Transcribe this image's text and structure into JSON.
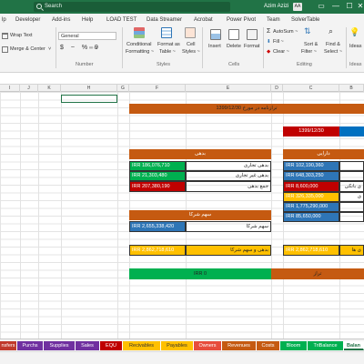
{
  "titlebar": {
    "search_placeholder": "Search",
    "user_name": "Azim Azizi",
    "avatar_initials": "AA",
    "minimize": "—",
    "maximize": "☐",
    "close": "✕"
  },
  "ribbon_tabs": [
    "lp",
    "Developer",
    "Add-ins",
    "Help",
    "LOAD TEST",
    "Data Streamer",
    "Acrobat",
    "Power Pivot",
    "Team",
    "SolverTable"
  ],
  "ribbon": {
    "wrap_text": "Wrap Text",
    "merge_center": "Merge & Center",
    "alignment_label": "",
    "number_format": "General",
    "number_symbols": "$ ~ % 9",
    "number_label": "Number",
    "conditional_formatting": [
      "Conditional",
      "Formatting ~"
    ],
    "format_as_table": [
      "Format as",
      "Table ~"
    ],
    "cell_styles": [
      "Cell",
      "Styles ~"
    ],
    "styles_label": "Styles",
    "insert": "Insert",
    "delete": "Delete",
    "format": "Format",
    "cells_label": "Cells",
    "autosum": "AutoSum ~",
    "fill": "Fill ~",
    "clear": "Clear ~",
    "sort_filter": [
      "Sort &",
      "Filter ~"
    ],
    "find_select": [
      "Find &",
      "Select ~"
    ],
    "editing_label": "Editing",
    "ideas": "Ideas",
    "ideas_label": "Ideas"
  },
  "columns": [
    "I",
    "J",
    "K",
    "H",
    "G",
    "F",
    "E",
    "D",
    "C",
    "B"
  ],
  "sheet": {
    "title": "ترازنامه در مورخ 1399/12/30",
    "date_cell": "1399/12/30",
    "liabilities_header": "بدهی",
    "assets_header": "دارایی",
    "liab_rows": [
      {
        "value": "IRR 186,076,710",
        "label": "بدهی تجاری"
      },
      {
        "value": "IRR 21,303,480",
        "label": "بدهی غیر تجاری"
      },
      {
        "value": "IRR 207,380,190",
        "label": "جمع بدهی"
      }
    ],
    "asset_values": [
      "IRR 102,190,360",
      "IRR 648,303,250",
      "IRR 8,600,000",
      "IRR 326,335,000",
      "IRR 1,775,290,000",
      "IRR 85,650,000"
    ],
    "asset_labels_partial": [
      "",
      "",
      "ی بانکی",
      "ی",
      "",
      ""
    ],
    "equity_header": "سهم شرکا",
    "equity_value": "IRR 2,655,338,420",
    "equity_label": "سهم شرکا",
    "total_liab_equity_value": "IRR 2,862,718,610",
    "total_liab_equity_label": "بدهی و سهم شرکا",
    "total_assets_value": "IRR 2,862,718,610",
    "total_assets_label": "ی ها",
    "diff_value": "IRR 0",
    "diff_label": "تراز"
  },
  "sheet_tabs": [
    {
      "label": "nsfers",
      "color": "#c0392b"
    },
    {
      "label": "Purchs",
      "color": "#7030a0"
    },
    {
      "label": "Supplies",
      "color": "#7030a0"
    },
    {
      "label": "Sales",
      "color": "#7030a0"
    },
    {
      "label": "EQU",
      "color": "#c00000"
    },
    {
      "label": "Recivables",
      "color": "#ffc000"
    },
    {
      "label": "Payables",
      "color": "#ffc000"
    },
    {
      "label": "Owners",
      "color": "#e74c3c"
    },
    {
      "label": "Revenues",
      "color": "#c55a11"
    },
    {
      "label": "Costs",
      "color": "#c55a11"
    },
    {
      "label": "Bloom",
      "color": "#00b050"
    },
    {
      "label": "TriBalance",
      "color": "#00b050"
    },
    {
      "label": "Balan",
      "color": "#ffffff"
    }
  ],
  "colors": {
    "excel_green": "#217346",
    "header_orange": "#c55a11",
    "red_row": "#c00000",
    "blue_cell": "#0070c0",
    "green_cell": "#00b050",
    "yellow_cell": "#ffc000",
    "cell_blue_light": "#2e75b6"
  }
}
